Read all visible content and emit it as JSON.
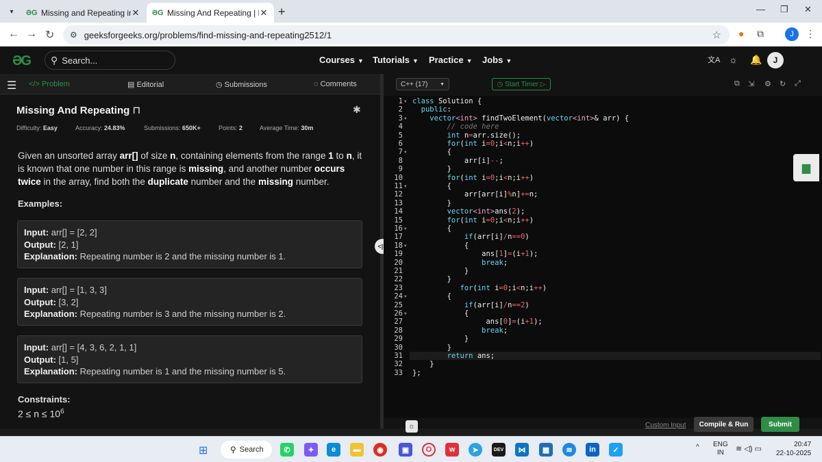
{
  "browser": {
    "tabs": [
      {
        "title": "Missing and Repeating in an Ar",
        "active": false
      },
      {
        "title": "Missing And Repeating | Practi",
        "active": true
      }
    ],
    "url": "geeksforgeeks.org/problems/find-missing-and-repeating2512/1",
    "profile_initial": "J"
  },
  "gfg_nav": {
    "search_placeholder": "Search...",
    "menu": [
      "Courses",
      "Tutorials",
      "Practice",
      "Jobs"
    ],
    "user_initial": "J"
  },
  "problem_tabs": [
    "Problem",
    "Editorial",
    "Submissions",
    "Comments"
  ],
  "problem": {
    "title": "Missing And Repeating",
    "meta": [
      {
        "label": "Difficulty:",
        "value": "Easy"
      },
      {
        "label": "Accuracy:",
        "value": "24.83%"
      },
      {
        "label": "Submissions:",
        "value": "650K+"
      },
      {
        "label": "Points:",
        "value": "2"
      },
      {
        "label": "Average Time:",
        "value": "30m"
      }
    ],
    "description_parts": [
      {
        "t": "Given an unsorted array ",
        "b": false
      },
      {
        "t": "arr[]",
        "b": true
      },
      {
        "t": " of size ",
        "b": false
      },
      {
        "t": "n",
        "b": true
      },
      {
        "t": ", containing elements from the range ",
        "b": false
      },
      {
        "t": "1",
        "b": true
      },
      {
        "t": " to ",
        "b": false
      },
      {
        "t": "n",
        "b": true
      },
      {
        "t": ", it is known that one number in this range is ",
        "b": false
      },
      {
        "t": "missing",
        "b": true
      },
      {
        "t": ", and another number ",
        "b": false
      },
      {
        "t": "occurs twice",
        "b": true
      },
      {
        "t": " in the array, find both the ",
        "b": false
      },
      {
        "t": "duplicate",
        "b": true
      },
      {
        "t": " number and the ",
        "b": false
      },
      {
        "t": "missing",
        "b": true
      },
      {
        "t": " number.",
        "b": false
      }
    ],
    "examples_heading": "Examples:",
    "examples": [
      {
        "input": "arr[] = [2, 2]",
        "output": "[2, 1]",
        "explanation": "Repeating number is 2 and the missing number is 1."
      },
      {
        "input": "arr[] = [1, 3, 3]",
        "output": "[3, 2]",
        "explanation": "Repeating number is 3 and the missing number is 2."
      },
      {
        "input": "arr[] = [4, 3, 6, 2, 1, 1]",
        "output": "[1, 5]",
        "explanation": "Repeating number is 1 and the missing number is 5."
      }
    ],
    "labels": {
      "input": "Input:",
      "output": "Output:",
      "explanation": "Explanation:"
    },
    "constraints_heading": "Constraints:",
    "constraint": {
      "base": "2 ≤ n ≤ 10",
      "exp": "6"
    }
  },
  "editor": {
    "language": "C++ (17)",
    "timer_label": "Start Timer",
    "current_line": 31,
    "lines": [
      [
        [
          "class ",
          "kw"
        ],
        [
          "Solution {",
          ""
        ]
      ],
      [
        [
          "  ",
          ""
        ],
        [
          "public",
          "kw"
        ],
        [
          ":",
          ""
        ]
      ],
      [
        [
          "    ",
          ""
        ],
        [
          "vector",
          "kw"
        ],
        [
          "<int>",
          "ty"
        ],
        [
          " findTwoElement(",
          ""
        ],
        [
          "vector",
          "kw"
        ],
        [
          "<int>",
          "ty"
        ],
        [
          "& arr) {",
          ""
        ]
      ],
      [
        [
          "        ",
          ""
        ],
        [
          "// code here",
          "cm"
        ]
      ],
      [
        [
          "        ",
          ""
        ],
        [
          "int",
          "kw"
        ],
        [
          " n",
          ""
        ],
        [
          "=",
          "op"
        ],
        [
          "arr.size();",
          ""
        ]
      ],
      [
        [
          "        ",
          ""
        ],
        [
          "for",
          "kw"
        ],
        [
          "(",
          ""
        ],
        [
          "int",
          "kw"
        ],
        [
          " i",
          ""
        ],
        [
          "=",
          "op"
        ],
        [
          "0",
          "nm"
        ],
        [
          ";i",
          ""
        ],
        [
          "<",
          "op"
        ],
        [
          "n;i",
          ""
        ],
        [
          "++",
          "op"
        ],
        [
          ")",
          ""
        ]
      ],
      [
        [
          "        {",
          ""
        ]
      ],
      [
        [
          "            arr[i]",
          ""
        ],
        [
          "--",
          "op"
        ],
        [
          ";",
          ""
        ]
      ],
      [
        [
          "        }",
          ""
        ]
      ],
      [
        [
          "        ",
          ""
        ],
        [
          "for",
          "kw"
        ],
        [
          "(",
          ""
        ],
        [
          "int",
          "kw"
        ],
        [
          " i",
          ""
        ],
        [
          "=",
          "op"
        ],
        [
          "0",
          "nm"
        ],
        [
          ";i",
          ""
        ],
        [
          "<",
          "op"
        ],
        [
          "n;i",
          ""
        ],
        [
          "++",
          "op"
        ],
        [
          ")",
          ""
        ]
      ],
      [
        [
          "        {",
          ""
        ]
      ],
      [
        [
          "            arr[arr[i]",
          ""
        ],
        [
          "%",
          "op"
        ],
        [
          "n]",
          ""
        ],
        [
          "+=",
          "op"
        ],
        [
          "n;",
          ""
        ]
      ],
      [
        [
          "        }",
          ""
        ]
      ],
      [
        [
          "        ",
          ""
        ],
        [
          "vector",
          "kw"
        ],
        [
          "<int>",
          "ty"
        ],
        [
          "ans(",
          ""
        ],
        [
          "2",
          "nm"
        ],
        [
          ");",
          ""
        ]
      ],
      [
        [
          "        ",
          ""
        ],
        [
          "for",
          "kw"
        ],
        [
          "(",
          ""
        ],
        [
          "int",
          "kw"
        ],
        [
          " i",
          ""
        ],
        [
          "=",
          "op"
        ],
        [
          "0",
          "nm"
        ],
        [
          ";i",
          ""
        ],
        [
          "<",
          "op"
        ],
        [
          "n;i",
          ""
        ],
        [
          "++",
          "op"
        ],
        [
          ")",
          ""
        ]
      ],
      [
        [
          "        {",
          ""
        ]
      ],
      [
        [
          "            ",
          ""
        ],
        [
          "if",
          "kw"
        ],
        [
          "(arr[i]",
          ""
        ],
        [
          "/",
          "op"
        ],
        [
          "n",
          ""
        ],
        [
          "==",
          "op"
        ],
        [
          "0",
          "nm"
        ],
        [
          ")",
          ""
        ]
      ],
      [
        [
          "            {",
          ""
        ]
      ],
      [
        [
          "                ans[",
          ""
        ],
        [
          "1",
          "nm"
        ],
        [
          "]",
          ""
        ],
        [
          "=",
          "op"
        ],
        [
          "(i",
          ""
        ],
        [
          "+",
          "op"
        ],
        [
          "1",
          "nm"
        ],
        [
          ");",
          ""
        ]
      ],
      [
        [
          "                ",
          ""
        ],
        [
          "break",
          "kw"
        ],
        [
          ";",
          ""
        ]
      ],
      [
        [
          "            }",
          ""
        ]
      ],
      [
        [
          "        }",
          ""
        ]
      ],
      [
        [
          "           ",
          ""
        ],
        [
          "for",
          "kw"
        ],
        [
          "(",
          ""
        ],
        [
          "int",
          "kw"
        ],
        [
          " i",
          ""
        ],
        [
          "=",
          "op"
        ],
        [
          "0",
          "nm"
        ],
        [
          ";i",
          ""
        ],
        [
          "<",
          "op"
        ],
        [
          "n;i",
          ""
        ],
        [
          "++",
          "op"
        ],
        [
          ")",
          ""
        ]
      ],
      [
        [
          "        {",
          ""
        ]
      ],
      [
        [
          "            ",
          ""
        ],
        [
          "if",
          "kw"
        ],
        [
          "(arr[i]",
          ""
        ],
        [
          "/",
          "op"
        ],
        [
          "n",
          ""
        ],
        [
          "==",
          "op"
        ],
        [
          "2",
          "nm"
        ],
        [
          ")",
          ""
        ]
      ],
      [
        [
          "            {",
          ""
        ]
      ],
      [
        [
          "                 ans[",
          ""
        ],
        [
          "0",
          "nm"
        ],
        [
          "]",
          ""
        ],
        [
          "=",
          "op"
        ],
        [
          "(i",
          ""
        ],
        [
          "+",
          "op"
        ],
        [
          "1",
          "nm"
        ],
        [
          ");",
          ""
        ]
      ],
      [
        [
          "                ",
          ""
        ],
        [
          "break",
          "kw"
        ],
        [
          ";",
          ""
        ]
      ],
      [
        [
          "            }",
          ""
        ]
      ],
      [
        [
          "        }",
          ""
        ]
      ],
      [
        [
          "        ",
          ""
        ],
        [
          "return",
          "kw"
        ],
        [
          " ans;",
          ""
        ]
      ],
      [
        [
          "    }",
          ""
        ]
      ],
      [
        [
          "};",
          ""
        ]
      ]
    ],
    "folds": [
      1,
      3,
      7,
      11,
      16,
      18,
      24,
      26
    ],
    "custom_input": "Custom Input",
    "compile_run": "Compile & Run",
    "submit": "Submit"
  },
  "taskbar": {
    "search_label": "Search",
    "lang_top": "ENG",
    "lang_bottom": "IN",
    "time": "20:47",
    "date": "22-10-2025"
  }
}
